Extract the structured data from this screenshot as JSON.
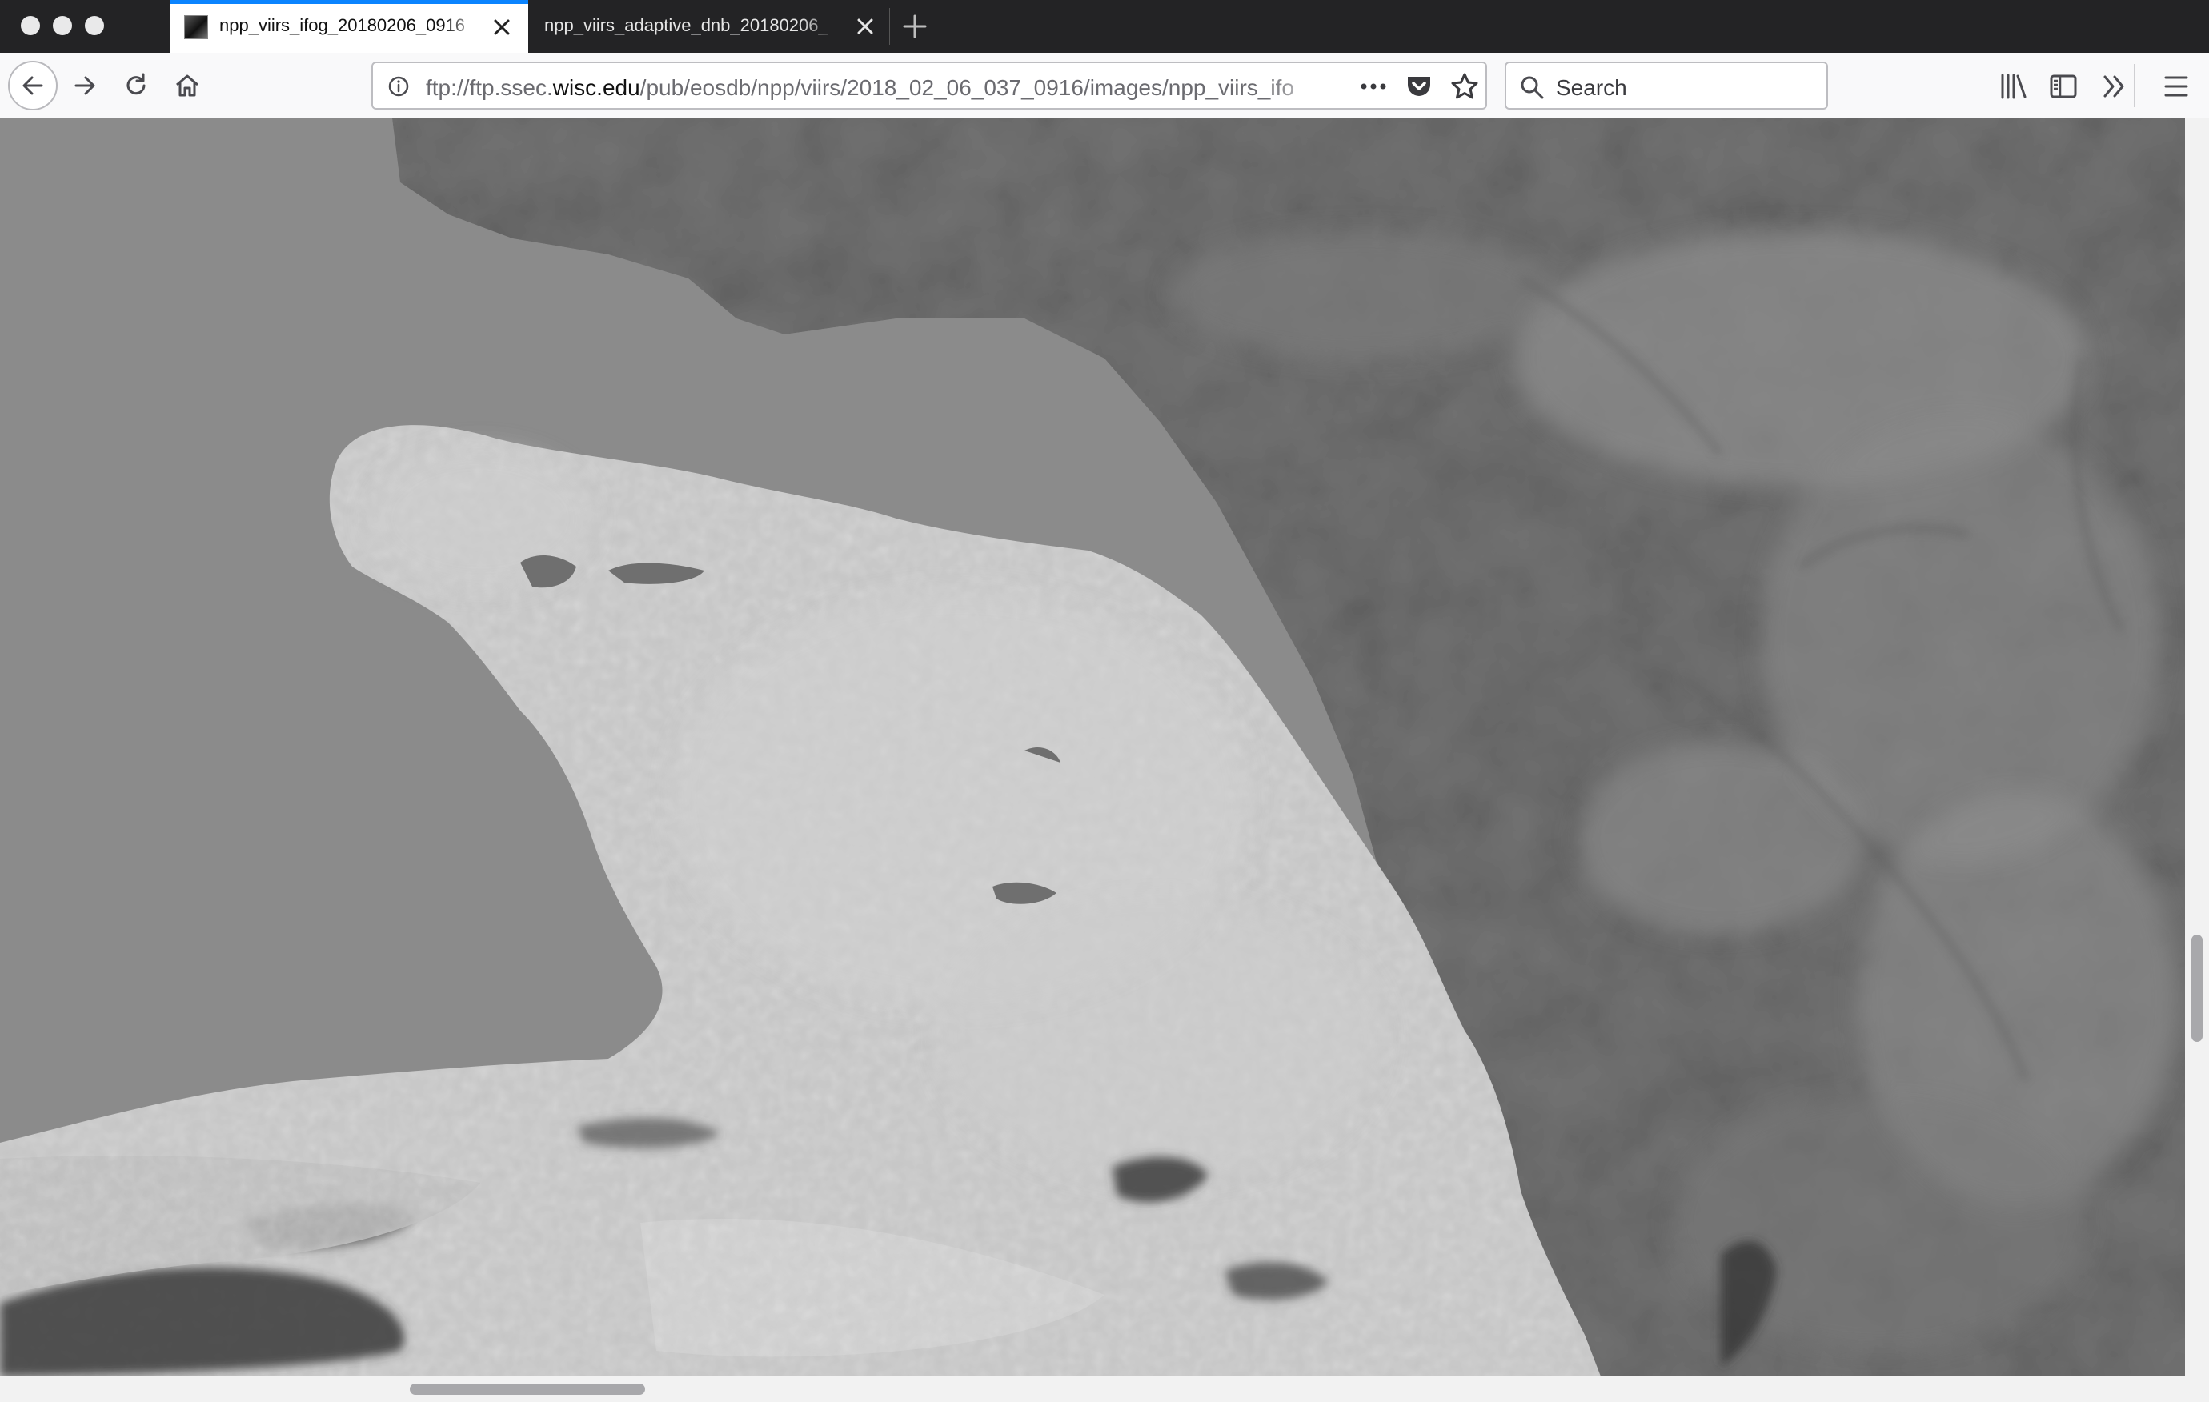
{
  "window": {
    "controls": [
      "close",
      "minimize",
      "zoom"
    ]
  },
  "tabs": [
    {
      "label": "npp_viirs_ifog_20180206_0916",
      "active": true,
      "icon": "image-thumbnail-icon"
    },
    {
      "label": "npp_viirs_adaptive_dnb_20180206_",
      "active": false
    }
  ],
  "toolbar": {
    "url": {
      "scheme": "ftp://ftp.ssec.",
      "host": "wisc.edu",
      "path": "/pub/eosdb/npp/viirs/2018_02_06_037_0916/images/npp_viirs_ifo"
    },
    "search_placeholder": "Search",
    "icons": [
      "back-icon",
      "forward-icon",
      "reload-icon",
      "home-icon",
      "info-icon",
      "page-actions-icon",
      "pocket-icon",
      "bookmark-star-icon",
      "search-icon",
      "library-icon",
      "sidebar-icon",
      "overflow-chevron-icon",
      "hamburger-menu-icon"
    ]
  },
  "content": {
    "type": "satellite image",
    "description_colors": {
      "ocean": "#8c8c8c",
      "land": "#6e6e6e",
      "fog": "#c8c8c8"
    }
  }
}
